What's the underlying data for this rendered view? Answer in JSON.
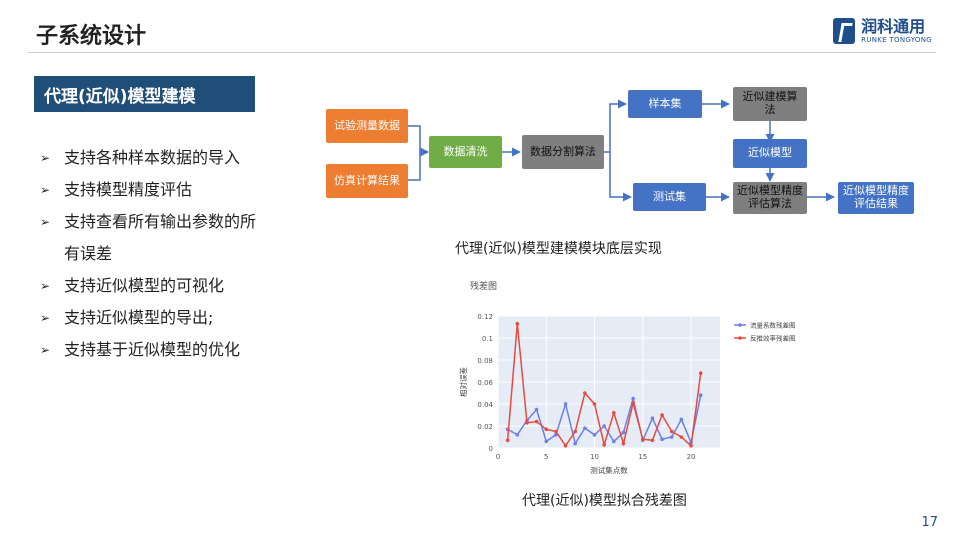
{
  "slide": {
    "title": "子系统设计",
    "page_number": "17"
  },
  "logo": {
    "cn": "润科通用",
    "en": "RUNKE TONGYONG"
  },
  "section": {
    "label": "代理(近似)模型建模"
  },
  "bullets": [
    "支持各种样本数据的导入",
    "支持模型精度评估",
    "支持查看所有输出参数的所有误差",
    "支持近似模型的可视化",
    "支持近似模型的导出;",
    "支持基于近似模型的优化"
  ],
  "diagram": {
    "nodes": {
      "test_data": "试验测量数据",
      "sim_data": "仿真计算结果",
      "clean": "数据清洗",
      "split": "数据分割算法",
      "sample": "样本集",
      "test": "测试集",
      "build_algo": "近似建模算法",
      "model": "近似模型",
      "eval_algo": "近似模型精度评估算法",
      "eval_result": "近似模型精度评估结果"
    },
    "caption": "代理(近似)模型建模模块底层实现"
  },
  "chart": {
    "caption": "代理(近似)模型拟合残差图"
  },
  "chart_data": {
    "type": "line",
    "title": "残差图",
    "xlabel": "测试集点数",
    "ylabel": "相对误差",
    "xlim": [
      0,
      23
    ],
    "ylim": [
      0,
      0.12
    ],
    "xticks": [
      0,
      5,
      10,
      15,
      20
    ],
    "yticks": [
      0,
      0.02,
      0.04,
      0.06,
      0.08,
      0.1,
      0.12
    ],
    "legend_position": "right",
    "x": [
      1,
      2,
      3,
      4,
      5,
      6,
      7,
      8,
      9,
      10,
      11,
      12,
      13,
      14,
      15,
      16,
      17,
      18,
      19,
      20,
      21
    ],
    "series": [
      {
        "name": "流量系数残差图",
        "color": "#6f7fe8",
        "values": [
          0.017,
          0.012,
          0.025,
          0.035,
          0.006,
          0.012,
          0.04,
          0.004,
          0.018,
          0.012,
          0.02,
          0.006,
          0.014,
          0.045,
          0.007,
          0.027,
          0.008,
          0.01,
          0.026,
          0.005,
          0.048
        ]
      },
      {
        "name": "反推效率残差图",
        "color": "#e84a3d",
        "values": [
          0.007,
          0.113,
          0.023,
          0.024,
          0.017,
          0.015,
          0.002,
          0.015,
          0.05,
          0.04,
          0.003,
          0.032,
          0.004,
          0.041,
          0.008,
          0.007,
          0.03,
          0.015,
          0.01,
          0.002,
          0.068
        ]
      }
    ]
  }
}
